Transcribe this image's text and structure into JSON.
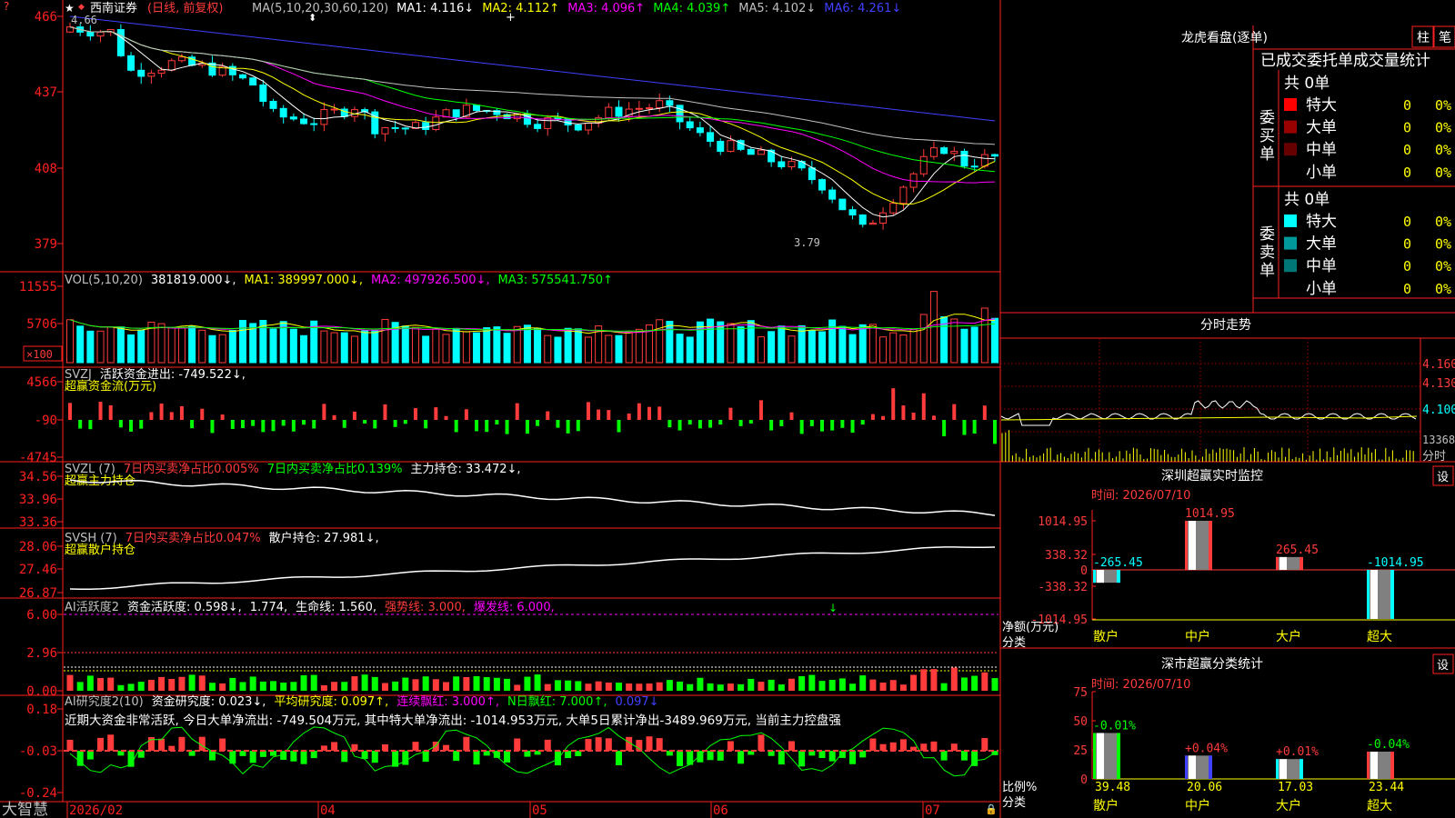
{
  "stock": {
    "name": "西南证券",
    "mode": "(日线, 前复权)"
  },
  "colors": {
    "red": "#ff3b3b",
    "cyan": "#00ffff",
    "green": "#00ff00",
    "yellow": "#ffff00",
    "magenta": "#ff00ff",
    "white": "#ffffff",
    "blue": "#4040ff",
    "grid": "#800000",
    "axis": "#ff2020"
  },
  "main_panel": {
    "legend": [
      {
        "text": "MA(5,10,20,30,60,120)",
        "color": "#c0c0c0"
      },
      {
        "text": "MA1: 4.116↓",
        "color": "#ffffff"
      },
      {
        "text": "MA2: 4.112↑",
        "color": "#ffff00"
      },
      {
        "text": "MA3: 4.096↑",
        "color": "#ff00ff"
      },
      {
        "text": "MA4: 4.039↑",
        "color": "#00ff00"
      },
      {
        "text": "MA5: 4.102↓",
        "color": "#c0c0c0"
      },
      {
        "text": "MA6: 4.261↓",
        "color": "#4040ff"
      }
    ],
    "yticks": [
      "466",
      "437",
      "408",
      "379"
    ],
    "high_label": "4.66",
    "low_label": "3.79"
  },
  "vol_panel": {
    "legend": [
      {
        "text": "VOL(5,10,20)",
        "color": "#c0c0c0"
      },
      {
        "text": "381819.000↓,",
        "color": "#ffffff"
      },
      {
        "text": "MA1: 389997.000↓,",
        "color": "#ffff00"
      },
      {
        "text": "MA2: 497926.500↓,",
        "color": "#ff00ff"
      },
      {
        "text": "MA3: 575541.750↑",
        "color": "#00ff00"
      }
    ],
    "yticks": [
      "11555",
      "5706"
    ],
    "unit": "×100"
  },
  "svzj_panel": {
    "legend": [
      {
        "text": "SVZJ",
        "color": "#c0c0c0"
      },
      {
        "text": "活跃资金进出: -749.522↓,",
        "color": "#ffffff"
      }
    ],
    "sub_label": "超赢资金流(万元)",
    "yticks": [
      "4566",
      "-90",
      "-4745"
    ]
  },
  "svzl_panel": {
    "legend": [
      {
        "text": "SVZL (7)",
        "color": "#c0c0c0"
      },
      {
        "text": "7日内买卖净占比0.005%",
        "color": "#ff3b3b"
      },
      {
        "text": "7日内买卖净占比0.139%",
        "color": "#00ff00"
      },
      {
        "text": "主力持仓: 33.472↓,",
        "color": "#ffffff"
      }
    ],
    "sub_label": "超赢主力持仓",
    "yticks": [
      "34.56",
      "33.96",
      "33.36"
    ]
  },
  "svsh_panel": {
    "legend": [
      {
        "text": "SVSH (7)",
        "color": "#c0c0c0"
      },
      {
        "text": "7日内买卖净占比0.047%",
        "color": "#ff3b3b"
      },
      {
        "text": "散户持仓: 27.981↓,",
        "color": "#ffffff"
      }
    ],
    "sub_label": "超赢散户持仓",
    "yticks": [
      "28.06",
      "27.46",
      "26.87"
    ]
  },
  "ai_panel": {
    "legend": [
      {
        "text": "AI活跃度2",
        "color": "#c0c0c0"
      },
      {
        "text": "资金活跃度: 0.598↓,",
        "color": "#ffffff"
      },
      {
        "text": "1.774,",
        "color": "#ffffff"
      },
      {
        "text": "生命线: 1.560,",
        "color": "#ffffff"
      },
      {
        "text": "强势线: 3.000,",
        "color": "#ff3b3b"
      },
      {
        "text": "爆发线: 6.000,",
        "color": "#ff00ff"
      }
    ],
    "yticks": [
      "6.00",
      "2.96",
      "0.00"
    ]
  },
  "ai2_panel": {
    "legend": [
      {
        "text": "AI研究度2(10)",
        "color": "#c0c0c0"
      },
      {
        "text": "资金研究度: 0.023↓,",
        "color": "#ffffff"
      },
      {
        "text": "平均研究度: 0.097↑,",
        "color": "#ffff00"
      },
      {
        "text": "连续飘红: 3.000↑,",
        "color": "#ff00ff"
      },
      {
        "text": "N日飘红: 7.000↑,",
        "color": "#00ff00"
      },
      {
        "text": "0.097↓",
        "color": "#4040ff"
      }
    ],
    "comment": "近期大资金非常活跃, 今日大单净流出: -749.504万元, 其中特大单净流出: -1014.953万元, 大单5日累计净出-3489.969万元, 当前主力控盘强",
    "yticks": [
      "0.18",
      "-0.03",
      "-0.24"
    ]
  },
  "time_axis": {
    "brand": "大智慧",
    "labels": [
      "2026/02",
      "04",
      "05",
      "06",
      "07"
    ]
  },
  "longhu": {
    "title": "龙虎看盘(逐单)",
    "buttons": [
      "柱",
      "笔"
    ],
    "subtitle": "已成交委托单成交量统计",
    "buy": {
      "side_label": "委买单",
      "total": "共 0单",
      "rows": [
        {
          "name": "特大",
          "val": "0",
          "pct": "0%",
          "color": "#ff0000"
        },
        {
          "name": "大单",
          "val": "0",
          "pct": "0%",
          "color": "#990000"
        },
        {
          "name": "中单",
          "val": "0",
          "pct": "0%",
          "color": "#660000"
        },
        {
          "name": "小单",
          "val": "0",
          "pct": "0%",
          "color": ""
        }
      ]
    },
    "sell": {
      "side_label": "委卖单",
      "total": "共 0单",
      "rows": [
        {
          "name": "特大",
          "val": "0",
          "pct": "0%",
          "color": "#00ffff"
        },
        {
          "name": "大单",
          "val": "0",
          "pct": "0%",
          "color": "#009999"
        },
        {
          "name": "中单",
          "val": "0",
          "pct": "0%",
          "color": "#007777"
        },
        {
          "name": "小单",
          "val": "0",
          "pct": "0%",
          "color": ""
        }
      ]
    }
  },
  "intraday": {
    "title": "分时走势",
    "yticks": [
      "4.160",
      "4.130",
      "4.100"
    ],
    "volume_label": "13368",
    "axis_label": "分时"
  },
  "sz_monitor": {
    "title": "深圳超赢实时监控",
    "settings_label": "设",
    "time": "时间: 2026/07/10",
    "yticks": [
      "1014.95",
      "338.32",
      "0",
      "-338.32",
      "-1014.95"
    ],
    "axis_unit": "净额(万元)",
    "axis_cat": "分类",
    "chart_data": {
      "type": "bar",
      "categories": [
        "散户",
        "中户",
        "大户",
        "超大"
      ],
      "values": [
        -265.45,
        1014.95,
        265.45,
        -1014.95
      ],
      "value_labels": [
        "-265.45",
        "1014.95",
        "265.45",
        "-1014.95"
      ],
      "ylim": [
        -1014.95,
        1014.95
      ]
    }
  },
  "sz_class": {
    "title": "深市超赢分类统计",
    "settings_label": "设",
    "time": "时间: 2026/07/10",
    "yticks": [
      "75",
      "50",
      "25",
      "0"
    ],
    "axis_unit": "比例%",
    "axis_cat": "分类",
    "chart_data": {
      "type": "bar",
      "categories": [
        "散户",
        "中户",
        "大户",
        "超大"
      ],
      "values": [
        39.48,
        20.06,
        17.03,
        23.44
      ],
      "changes": [
        "-0.01%",
        "+0.04%",
        "+0.01%",
        "-0.04%"
      ],
      "ylim": [
        0,
        75
      ]
    }
  }
}
